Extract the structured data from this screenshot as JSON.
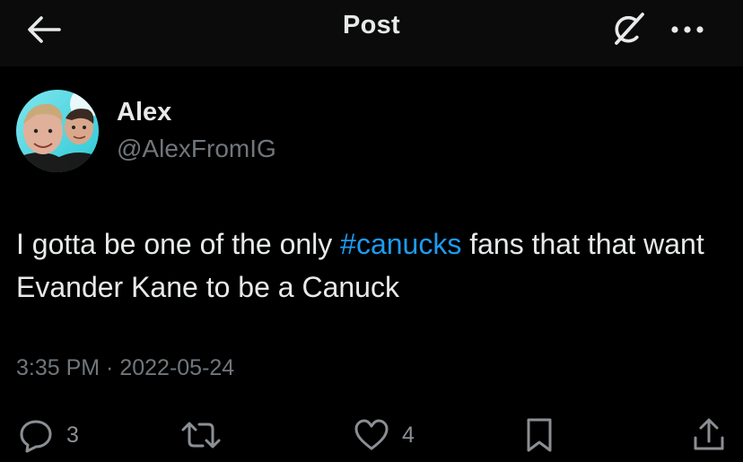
{
  "header": {
    "title": "Post",
    "back_icon": "arrow-left-icon",
    "grok_icon": "grok-icon",
    "more_icon": "more-horizontal-icon"
  },
  "author": {
    "name": "Alex",
    "handle": "@AlexFromIG"
  },
  "tweet": {
    "text_before": "I gotta be one of the only ",
    "hashtag": "#canucks",
    "text_after": " fans that that want Evander Kane to be a Canuck",
    "time": "3:35 PM",
    "separator": " · ",
    "date": "2022-05-24"
  },
  "actions": {
    "reply_count": "3",
    "retweet_count": "",
    "like_count": "4"
  },
  "colors": {
    "background": "#000000",
    "header_background": "#0b0b0b",
    "primary_text": "#e7e9ea",
    "secondary_text": "#71767b",
    "accent": "#1d9bf0"
  }
}
